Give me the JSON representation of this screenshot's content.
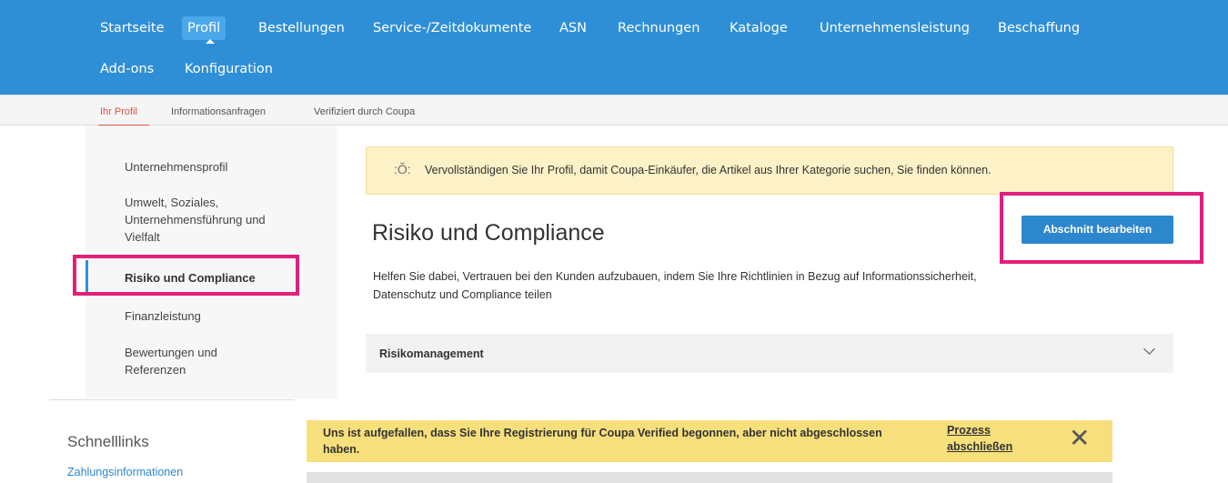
{
  "topnav": {
    "row1": [
      "Startseite",
      "Profil",
      "Bestellungen",
      "Service-/Zeitdokumente",
      "ASN",
      "Rechnungen",
      "Kataloge",
      "Unternehmensleistung",
      "Beschaffung"
    ],
    "row2": [
      "Add-ons",
      "Konfiguration"
    ]
  },
  "subnav": [
    "Ihr Profil",
    "Informationsanfragen",
    "Verifiziert durch Coupa"
  ],
  "sidemenu": [
    "Unternehmensprofil",
    "Umwelt, Soziales, Unternehmensführung und Vielfalt",
    "Risiko und Compliance",
    "Finanzleistung",
    "Bewertungen und Referenzen"
  ],
  "banner": {
    "icon": "lightbulb-icon",
    "text": "Vervollständigen Sie Ihr Profil, damit Coupa-Einkäufer, die Artikel aus Ihrer Kategorie suchen, Sie finden können."
  },
  "main": {
    "title": "Risiko und Compliance",
    "edit_button": "Abschnitt bearbeiten",
    "description": "Helfen Sie dabei, Vertrauen bei den Kunden aufzubauen, indem Sie Ihre Richtlinien in Bezug auf Informationssicherheit, Datenschutz und Compliance teilen",
    "accordion_label": "Risikomanagement"
  },
  "quicklinks": {
    "title": "Schnelllinks",
    "link": "Zahlungsinformationen"
  },
  "notice": {
    "text": "Uns ist aufgefallen, dass Sie Ihre Registrierung für Coupa Verified begonnen, aber nicht abgeschlossen haben.",
    "link": "Prozess abschließen",
    "close": "✕"
  },
  "colors": {
    "nav_bg": "#2f8fd6",
    "active_subnav": "#d8534a",
    "primary_button": "#2d87cc",
    "highlight_box": "#e0207a",
    "notice_bg": "#f7df7c",
    "banner_bg": "#fdf1c7"
  }
}
